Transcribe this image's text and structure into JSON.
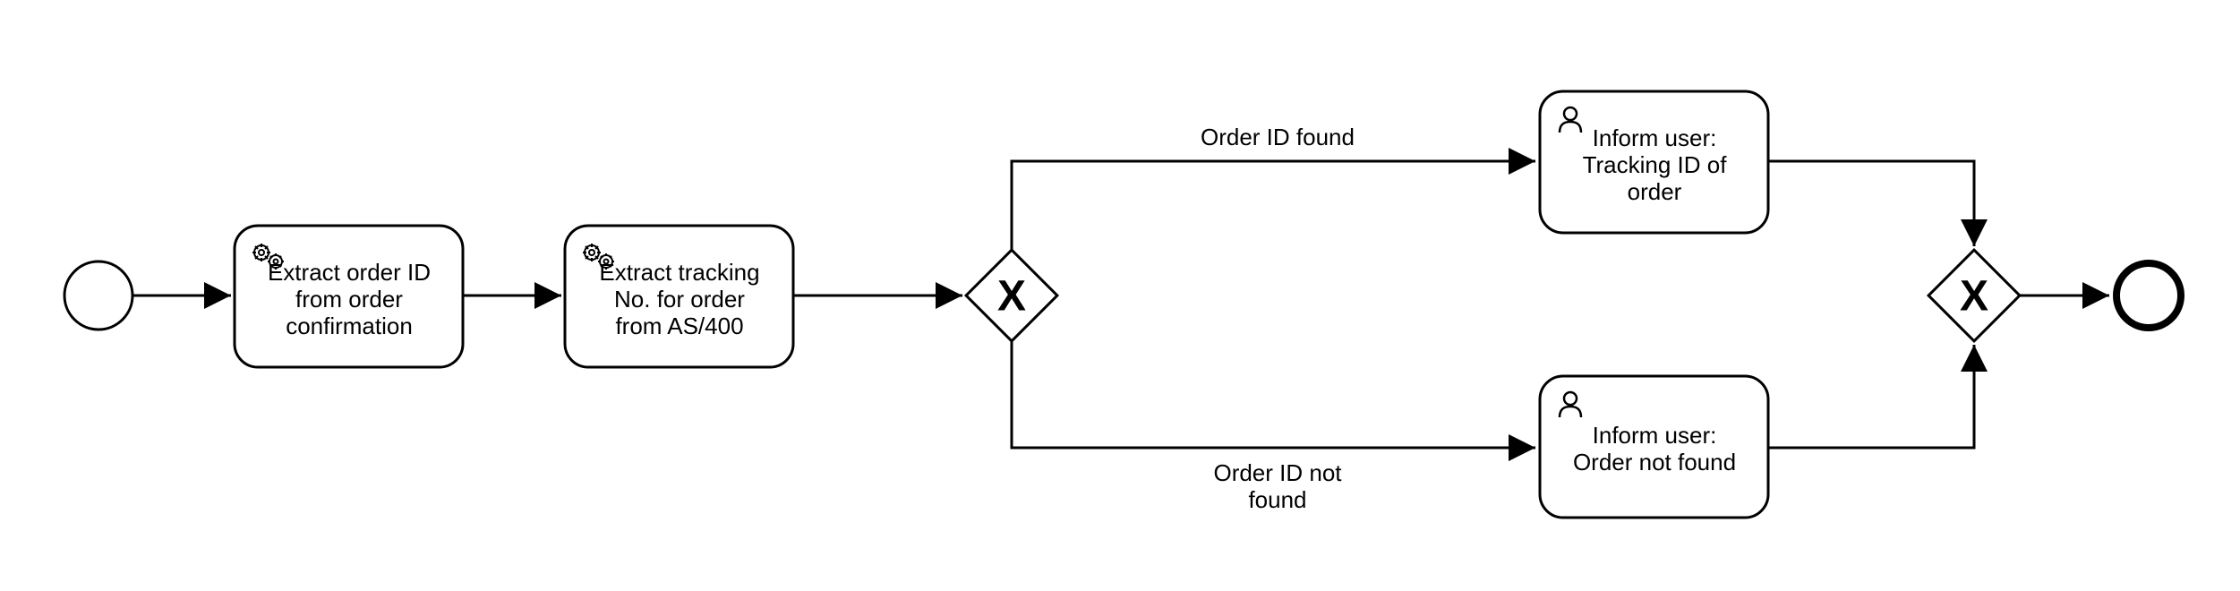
{
  "diagram": {
    "type": "BPMN",
    "tasks": {
      "extract_order_id": {
        "line1": "Extract order ID",
        "line2": "from order",
        "line3": "confirmation"
      },
      "extract_tracking": {
        "line1": "Extract tracking",
        "line2": "No. for order",
        "line3": "from AS/400"
      },
      "inform_tracking": {
        "line1": "Inform user:",
        "line2": "Tracking ID of",
        "line3": "order"
      },
      "inform_not_found": {
        "line1": "Inform user:",
        "line2": "Order not found"
      }
    },
    "labels": {
      "found": "Order ID found",
      "not_found_line1": "Order ID not",
      "not_found_line2": "found"
    },
    "gateways": {
      "split": "X",
      "merge": "X"
    }
  }
}
